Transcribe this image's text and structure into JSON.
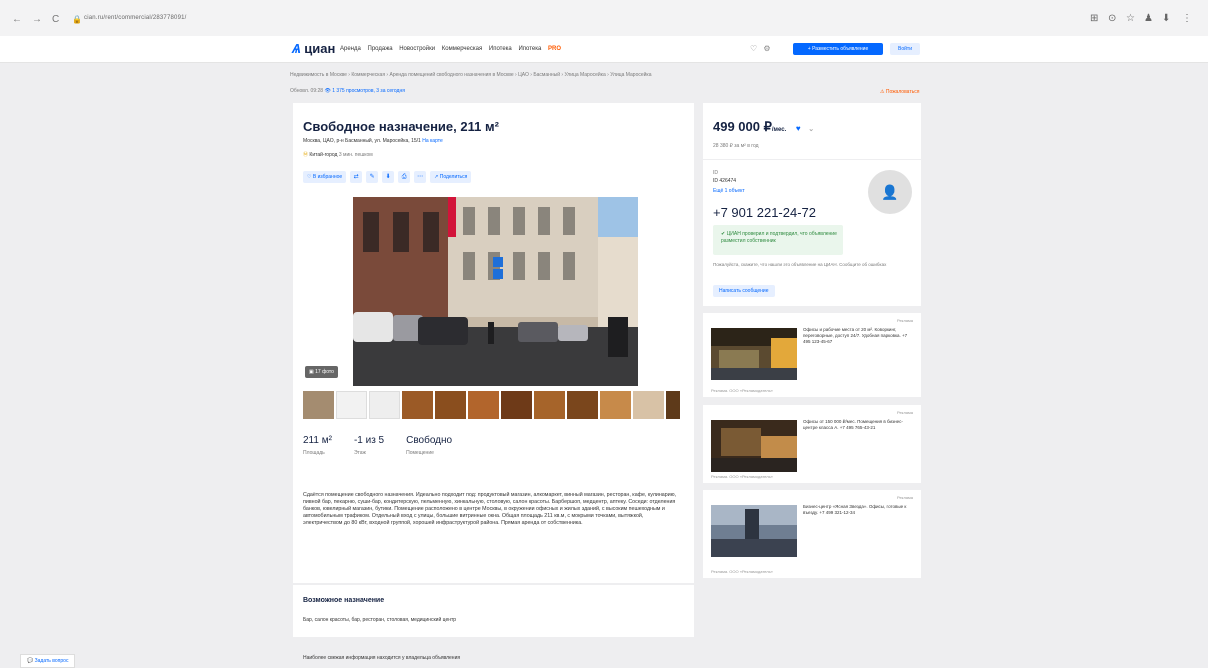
{
  "browser": {
    "nav_back": "←",
    "nav_forward": "→",
    "nav_reload": "C",
    "url": "cian.ru/rent/commercial/283778091/",
    "toolbar_icons": [
      "⊞",
      "⊙",
      "☆",
      "♟",
      "⬇",
      "⋮"
    ]
  },
  "header": {
    "logo_mark": "Ѧ",
    "logo_text": "циан",
    "nav": [
      "Аренда",
      "Продажа",
      "Новостройки",
      "Коммерческая",
      "Ипотека",
      "Ипотека",
      "PRO"
    ],
    "place_ad": "+ Разместить объявление",
    "login": "Войти"
  },
  "breadcrumbs": "Недвижимость в Москве › Коммерческая › Аренда помещений свободного назначения в Москве › ЦАО › Басманный › Улица Маросейка › Улица Маросейка",
  "updated": {
    "date": "Обновл. 09:28",
    "views": "1 375 просмотров, 3 за сегодня"
  },
  "report": "Пожаловаться",
  "listing": {
    "title": "Свободное назначение, 211 м²",
    "address": "Москва, ЦАО, р-н Басманный, ул. Маросейка, 15/1",
    "map_link": "На карте",
    "metro": "Китай-город",
    "metro_time": "3 мин. пешком",
    "actions": {
      "favorite": "В избранное",
      "share": "Поделиться",
      "icons": [
        "compare-icon",
        "edit-icon",
        "download-icon",
        "print-icon",
        "more-icon"
      ]
    },
    "photo_count": "17 фото",
    "params": [
      {
        "value": "211 м²",
        "label": "Площадь"
      },
      {
        "value": "-1 из 5",
        "label": "Этаж"
      },
      {
        "value": "Свободно",
        "label": "Помещение"
      }
    ],
    "description": "Сдаётся помещение свободного назначения. Идеально подходит под: продуктовый магазин, алкомаркет, винный магазин, ресторан, кафе, кулинарию, пивной бар, пекарню, суши-бар, кондитерскую, пельменную, хинкальную, столовую, салон красоты. Барбершоп, медцентр, аптеку. Соседи: отделения банков, ювелирный магазин, бутики. Помещение расположено в центре Москвы, в окружении офисных и жилых зданий, с высоким пешеходным и автомобильным трафиком. Отдельный вход с улицы, большие витринные окна. Общая площадь 211 кв.м, с мокрыми точками, вытяжкой, электричеством до 80 кВт, входной группой, хорошей инфраструктурой района. Прямая аренда от собственника.",
    "purpose_title": "Возможное назначение",
    "purpose_text": "Бар, салон красоты, бар, ресторан, столовая, медицинский центр",
    "footnote": "Наиболее свежая информация находится у владельца объявления"
  },
  "price": {
    "value": "499 000 ₽",
    "per": "/мес.",
    "sub": "28 380 ₽ за м² в год"
  },
  "agent": {
    "label": "ID",
    "id": "ID 426474",
    "docs": "Ещё 1 объект",
    "phone": "+7 901 221-24-72",
    "verified": "ЦИАН проверил и подтвердил, что объявление разместил собственник",
    "note": "Пожалуйста, скажите, что нашли это объявление на ЦИАН. Сообщите об ошибках",
    "write": "Написать сообщение"
  },
  "ads": [
    {
      "tag": "Реклама",
      "text": "Офисы и рабочие места от 20 м². Коворкинг, переговорные, доступ 24/7. Удобная парковка. +7 495 123-45-67",
      "foot": "Реклама. ООО «Рекламодатель»"
    },
    {
      "tag": "Реклама",
      "text": "Офисы от 150 000 ₽/мес. Помещения в бизнес-центре класса А. +7 495 765-43-21",
      "foot": "Реклама. ООО «Рекламодатель»"
    },
    {
      "tag": "Реклама",
      "text": "Бизнес-центр «Ясная Звезда». Офисы, готовые к въезду. +7 499 321-12-34",
      "foot": "Реклама. ООО «Рекламодатель»"
    }
  ],
  "chat": "Задать вопрос"
}
